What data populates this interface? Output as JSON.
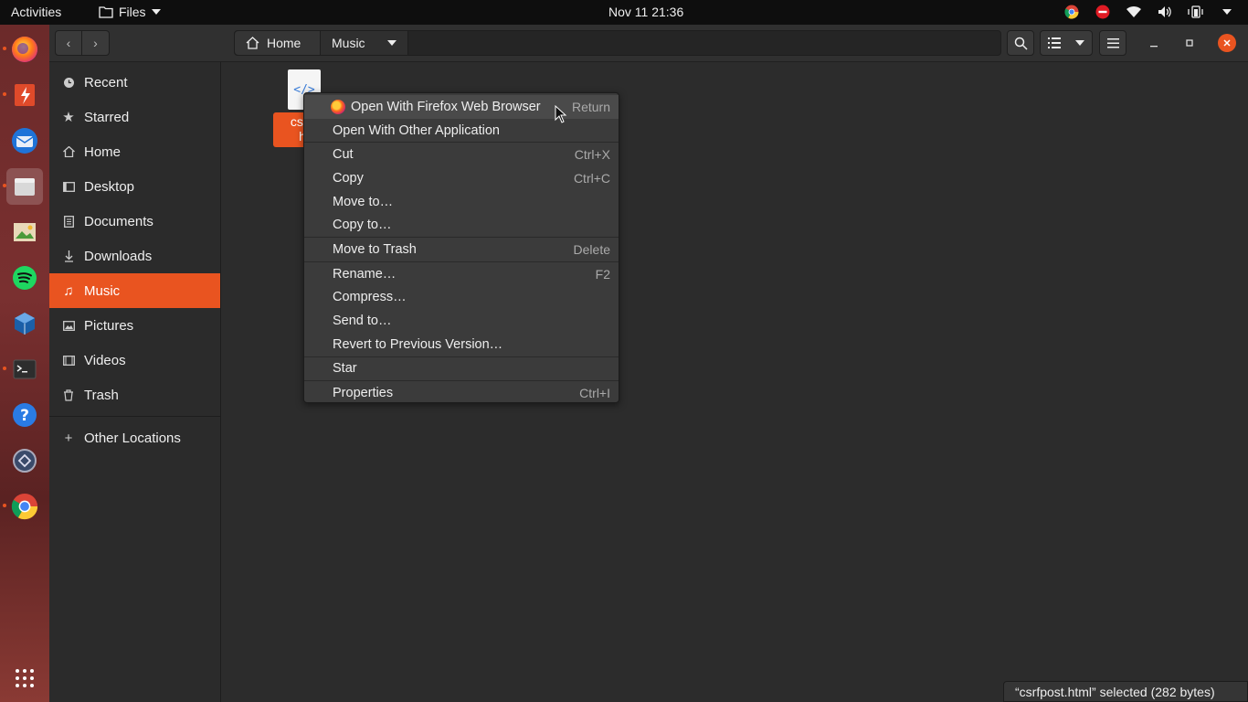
{
  "topbar": {
    "activities": "Activities",
    "app_name": "Files",
    "clock": "Nov 11  21:36",
    "tray_icons": [
      "chrome-icon",
      "do-not-disturb-icon",
      "wifi-icon",
      "volume-icon",
      "battery-icon",
      "chevron-down-icon"
    ]
  },
  "dock": {
    "apps": [
      "firefox",
      "app-launcher-red",
      "thunderbird",
      "files",
      "image-viewer",
      "spotify",
      "virtualbox",
      "terminal",
      "help",
      "settings-circle",
      "chrome"
    ],
    "show_apps": "show-applications-icon"
  },
  "header": {
    "breadcrumb_home": "Home",
    "breadcrumb_current": "Music"
  },
  "sidebar": {
    "items": [
      {
        "label": "Recent",
        "icon": "clock-icon"
      },
      {
        "label": "Starred",
        "icon": "star-icon"
      },
      {
        "label": "Home",
        "icon": "home-icon"
      },
      {
        "label": "Desktop",
        "icon": "desktop-icon"
      },
      {
        "label": "Documents",
        "icon": "document-icon"
      },
      {
        "label": "Downloads",
        "icon": "download-icon"
      },
      {
        "label": "Music",
        "icon": "music-icon"
      },
      {
        "label": "Pictures",
        "icon": "picture-icon"
      },
      {
        "label": "Videos",
        "icon": "video-icon"
      },
      {
        "label": "Trash",
        "icon": "trash-icon"
      }
    ],
    "other_locations": "Other Locations",
    "selected": "Music"
  },
  "file": {
    "name_line1": "csrfp",
    "name_line2": "ht"
  },
  "context_menu": {
    "items": [
      {
        "label": "Open With Firefox Web Browser",
        "accel": "Return"
      },
      {
        "label": "Open With Other Application",
        "accel": ""
      },
      {
        "label": "Cut",
        "accel": "Ctrl+X"
      },
      {
        "label": "Copy",
        "accel": "Ctrl+C"
      },
      {
        "label": "Move to…",
        "accel": ""
      },
      {
        "label": "Copy to…",
        "accel": ""
      },
      {
        "label": "Move to Trash",
        "accel": "Delete"
      },
      {
        "label": "Rename…",
        "accel": "F2"
      },
      {
        "label": "Compress…",
        "accel": ""
      },
      {
        "label": "Send to…",
        "accel": ""
      },
      {
        "label": "Revert to Previous Version…",
        "accel": ""
      },
      {
        "label": "Star",
        "accel": ""
      },
      {
        "label": "Properties",
        "accel": "Ctrl+I"
      }
    ]
  },
  "status": {
    "text": "“csrfpost.html” selected  (282 bytes)"
  },
  "colors": {
    "accent": "#e95420",
    "panel": "#0e0e0e",
    "background": "#2c2c2c"
  }
}
